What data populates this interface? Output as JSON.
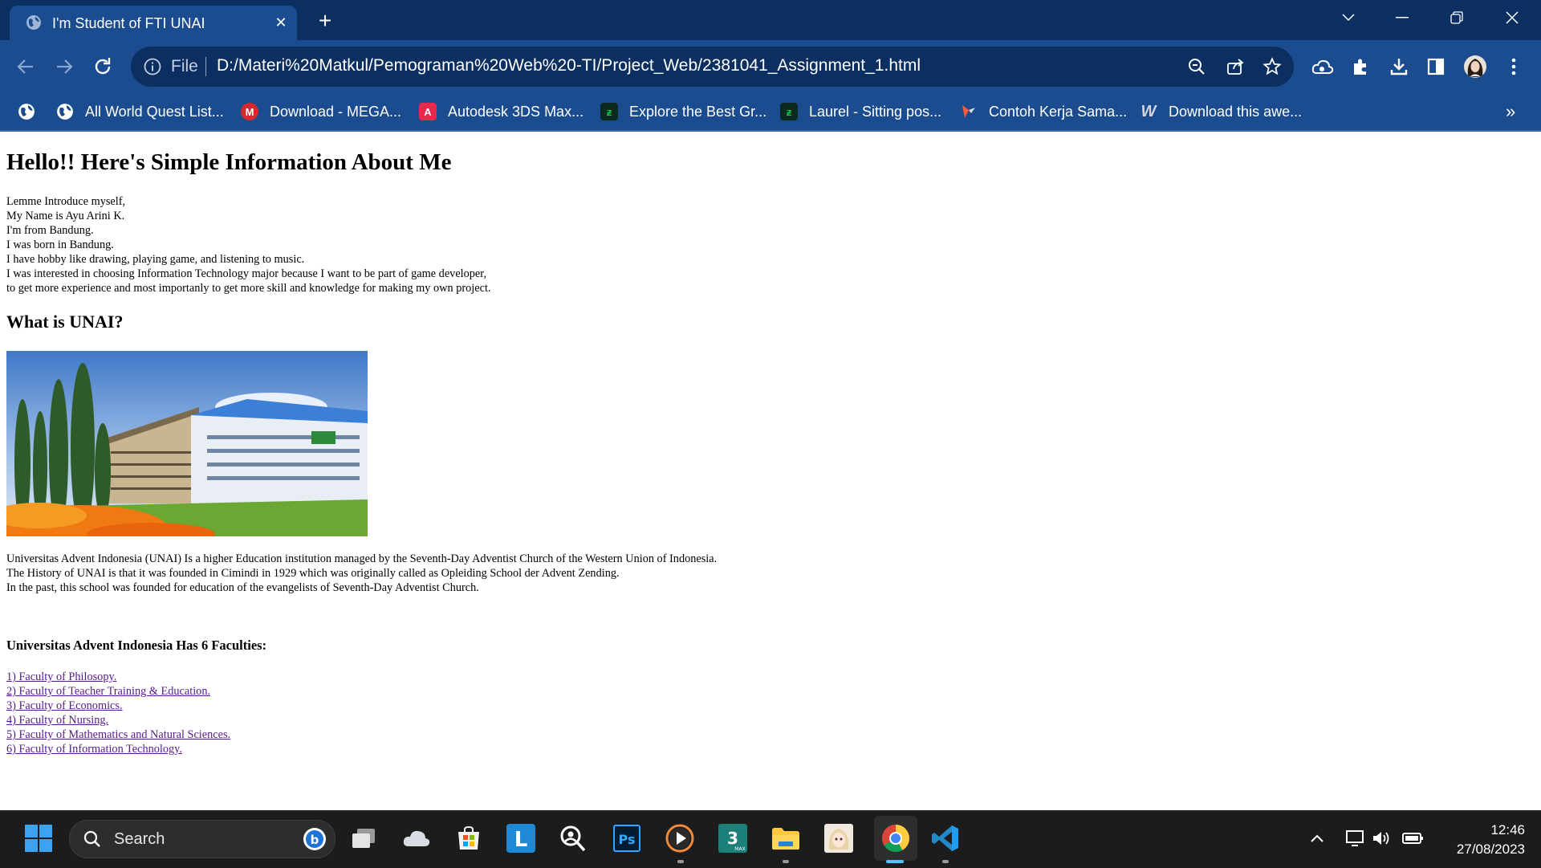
{
  "browser": {
    "tab": {
      "title": "I'm Student of FTI UNAI",
      "favicon": "globe-icon"
    },
    "address": {
      "scheme_label": "File",
      "url": "D:/Materi%20Matkul/Pemograman%20Web%20-TI/Project_Web/2381041_Assignment_1.html"
    },
    "bookmarks": [
      {
        "label": "All World Quest List...",
        "icon": "globe-icon",
        "color": "#ffffff"
      },
      {
        "label": "Download - MEGA...",
        "icon": "mega-icon",
        "color": "#d9272e"
      },
      {
        "label": "Autodesk 3DS Max...",
        "icon": "autodesk-icon",
        "color": "#e8294a"
      },
      {
        "label": "Explore the Best Gr...",
        "icon": "deviantart-icon",
        "color": "#05cc47"
      },
      {
        "label": "Laurel - Sitting pos...",
        "icon": "deviantart-icon",
        "color": "#05cc47"
      },
      {
        "label": "Contoh Kerja Sama...",
        "icon": "pinwheel-icon",
        "color": "#ff5a36"
      },
      {
        "label": "Download this awe...",
        "icon": "wallpaper-w-icon",
        "color": "#d0d6e0"
      }
    ],
    "bookmarks_more": "»"
  },
  "page": {
    "heading": "Hello!! Here's Simple Information About Me",
    "intro_lines": [
      "Lemme Introduce myself,",
      "My Name is Ayu Arini K.",
      "I'm from Bandung.",
      "I was born in Bandung.",
      "I have hobby like drawing, playing game, and listening to music.",
      "I was interested in choosing Information Technology major because I want to be part of game developer,",
      "to get more experience and most importanly to get more skill and knowledge for making my own project."
    ],
    "subheading": "What is UNAI?",
    "about_lines": [
      "Universitas Advent Indonesia (UNAI) Is a higher Education institution managed by the Seventh-Day Adventist Church of the Western Union of Indonesia.",
      "The History of UNAI is that it was founded in Cimindi in 1929 which was originally called as Opleiding School der Advent Zending.",
      "In the past, this school was founded for education of the evangelists of Seventh-Day Adventist Church."
    ],
    "faculties_heading": "Universitas Advent Indonesia Has 6 Faculties:",
    "faculties": [
      "1) Faculty of Philosopy.",
      "2) Faculty of Teacher Training & Education.",
      "3) Faculty of Economics.",
      "4) Faculty of Nursing.",
      "5) Faculty of Mathematics and Natural Sciences.",
      "6) Faculty of Information Technology."
    ],
    "link_color": "#551a8b"
  },
  "taskbar": {
    "search_label": "Search",
    "time": "12:46",
    "date": "27/08/2023"
  }
}
